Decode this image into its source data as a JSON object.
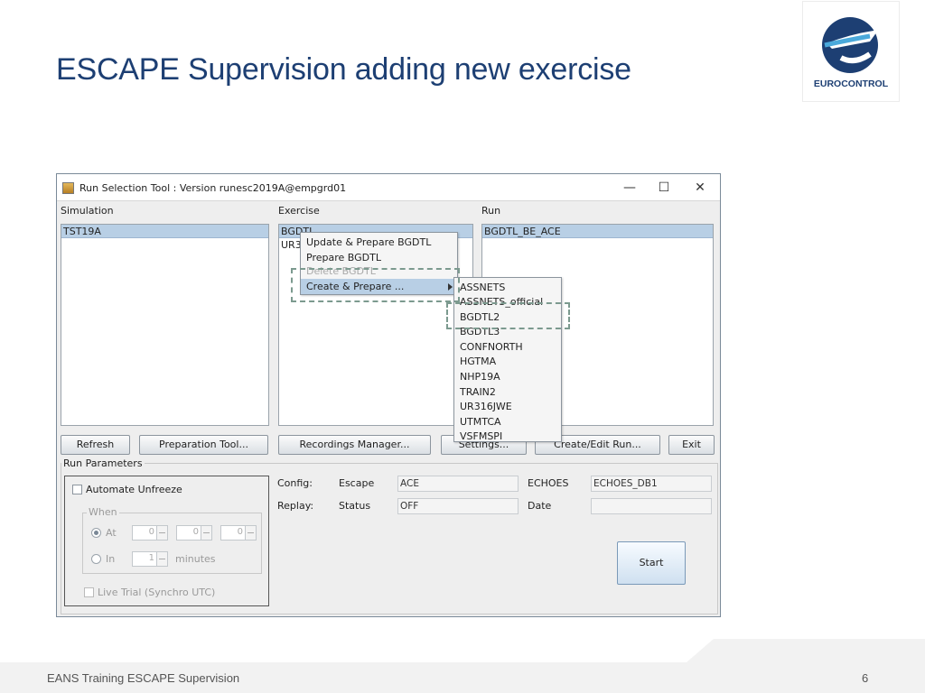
{
  "slide": {
    "title": "ESCAPE Supervision adding new exercise",
    "footer": "EANS Training ESCAPE Supervision",
    "page_number": "6",
    "logo_text": "EUROCONTROL"
  },
  "window": {
    "title": "Run Selection Tool : Version runesc2019A@empgrd01",
    "controls": {
      "minimize": "—",
      "maximize": "☐",
      "close": "✕"
    }
  },
  "simulation": {
    "label": "Simulation",
    "selected": "TST19A"
  },
  "exercise": {
    "label": "Exercise",
    "selected": "BGDTL",
    "second_partial": "UR3"
  },
  "run": {
    "label": "Run",
    "selected": "BGDTL_BE_ACE"
  },
  "context_menu": {
    "items": [
      "Update & Prepare BGDTL",
      "Prepare BGDTL",
      "Delete BGDTL",
      "Create & Prepare ..."
    ]
  },
  "submenu": {
    "items": [
      "ASSNETS",
      "ASSNETS_official",
      "BGDTL2",
      "BGDTL3",
      "CONFNORTH",
      "HGTMA",
      "NHP19A",
      "TRAIN2",
      "UR316JWE",
      "UTMTCA",
      "VSFMSPI"
    ]
  },
  "buttons": {
    "refresh": "Refresh",
    "preparation_tool": "Preparation Tool...",
    "recordings_manager": "Recordings Manager...",
    "settings": "Settings...",
    "create_edit_run": "Create/Edit Run...",
    "exit": "Exit",
    "start": "Start"
  },
  "run_parameters": {
    "label": "Run Parameters",
    "automate_unfreeze": "Automate Unfreeze",
    "when_label": "When",
    "at_label": "At",
    "in_label": "In",
    "at_values": [
      "0",
      "0",
      "0"
    ],
    "in_value": "1",
    "minutes_label": "minutes",
    "live_trial": "Live Trial (Synchro UTC)"
  },
  "config": {
    "config_label": "Config:",
    "escape_label": "Escape",
    "escape_value": "ACE",
    "echoes_label": "ECHOES",
    "echoes_value": "ECHOES_DB1",
    "replay_label": "Replay:",
    "status_label": "Status",
    "status_value": "OFF",
    "date_label": "Date",
    "date_value": ""
  },
  "colors": {
    "title_blue": "#1d3f73",
    "selection_blue": "#b8cfe5",
    "callout_dash": "#7c9a8f"
  }
}
